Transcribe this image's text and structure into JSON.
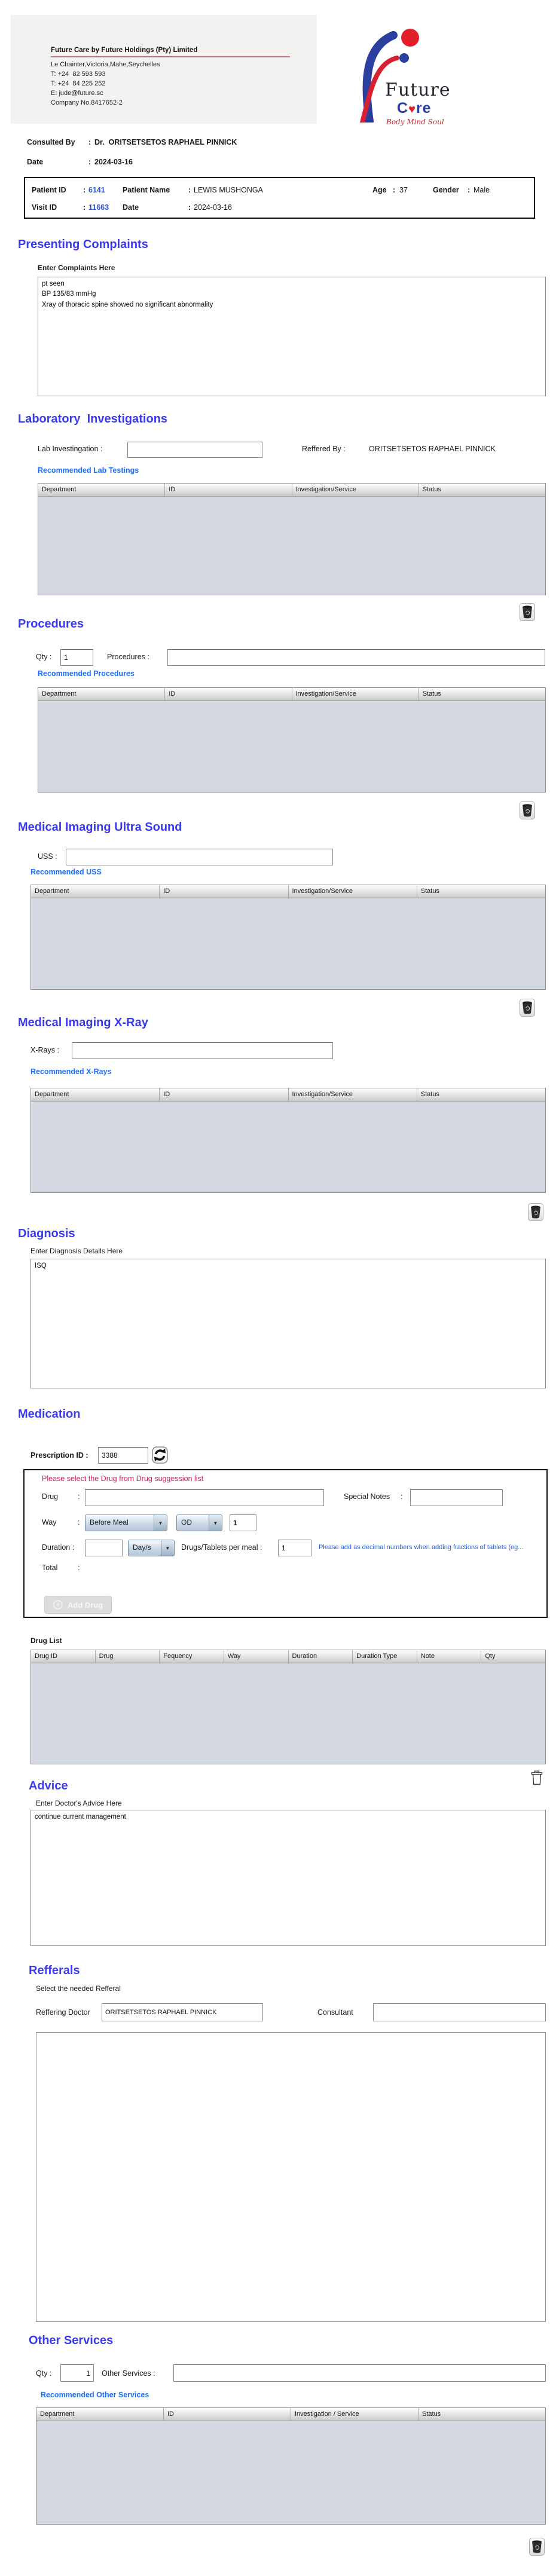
{
  "punct": {
    "colon": ":"
  },
  "icons": {
    "dropdown_arrow": "▼",
    "plus": "+",
    "heart": "♥"
  },
  "colors": {
    "heading_blue": "#3a3af0",
    "link_blue": "#1d6ff5",
    "id_blue": "#2f55d4",
    "warning_red": "#e0155a",
    "hint_blue": "#1e56d8",
    "logo_blue": "#2b3f9e",
    "logo_red": "#e31f2b",
    "table_body_gray": "#d4d8e0"
  },
  "header": {
    "company_title": "Future Care by Future Holdings (Pty) Limited",
    "address_lines": {
      "0": "Le Chainter,Victoria,Mahe,Seychelles",
      "1": "T: +24  82 593 593",
      "2": "T: +24  84 225 252",
      "3": "E: jude@future.sc",
      "4": "Company No.8417652-2"
    },
    "logo": {
      "future": "Future",
      "care_c": "C",
      "care_re": "re",
      "tagline": "Body Mind Soul"
    }
  },
  "consultation": {
    "consulted_by_label": "Consulted By",
    "consulted_by": "Dr.  ORITSETSETOS RAPHAEL PINNICK",
    "date_label": "Date",
    "date": "2024-03-16"
  },
  "patient": {
    "patient_id_label": "Patient ID",
    "patient_id": "6141",
    "patient_name_label": "Patient Name",
    "patient_name": "LEWIS MUSHONGA",
    "age_label": "Age",
    "age": "37",
    "gender_label": "Gender",
    "gender": "Male",
    "visit_id_label": "Visit ID",
    "visit_id": "11663",
    "date_label": "Date",
    "visit_date": "2024-03-16"
  },
  "presenting_complaints": {
    "title": "Presenting Complaints",
    "label": "Enter Complaints Here",
    "value": "pt seen\nBP 135/83 mmHg\nXray of thoracic spine showed no significant abnormality"
  },
  "laboratory": {
    "title": "Laboratory  Investigations",
    "lab_label": "Lab Investingation :",
    "lab_value": "",
    "referred_by_label": "Reffered By :",
    "referred_by": "ORITSETSETOS RAPHAEL PINNICK",
    "link": "Recommended Lab Testings",
    "columns": {
      "0": "Department",
      "1": "ID",
      "2": "Investigation/Service",
      "3": "Status"
    }
  },
  "procedures": {
    "title": "Procedures",
    "qty_label": "Qty :",
    "qty": "1",
    "procedures_label": "Procedures :",
    "procedures_value": "",
    "link": "Recommended Procedures",
    "columns": {
      "0": "Department",
      "1": "ID",
      "2": "Investigation/Service",
      "3": "Status"
    }
  },
  "uss": {
    "title": "Medical Imaging Ultra Sound",
    "label": "USS :",
    "value": "",
    "link": "Recommended USS",
    "columns": {
      "0": "Department",
      "1": "ID",
      "2": "Investigation/Service",
      "3": "Status"
    }
  },
  "xray": {
    "title": "Medical Imaging X-Ray",
    "label": "X-Rays :",
    "value": "",
    "link": "Recommended X-Rays",
    "columns": {
      "0": "Department",
      "1": "ID",
      "2": "Investigation/Service",
      "3": "Status"
    }
  },
  "diagnosis": {
    "title": "Diagnosis",
    "label": "Enter Diagnosis Details Here",
    "value": "ISQ"
  },
  "medication": {
    "title": "Medication",
    "prescription_id_label": "Prescription ID :",
    "prescription_id": "3388",
    "warning": "Please select the Drug from Drug suggession list",
    "drug_label": "Drug",
    "drug_value": "",
    "special_notes_label": "Special Notes",
    "special_notes_value": "",
    "way_label": "Way",
    "way_value": "Before Meal",
    "frequency_value": "OD",
    "way_qty": "1",
    "duration_label": "Duration :",
    "duration_value": "",
    "duration_type": "Day/s",
    "per_meal_label": "Drugs/Tablets per meal :",
    "per_meal": "1",
    "hint": "Please add as decimal numbers when adding fractions of tablets (eg...",
    "total_label": "Total",
    "add_drug_label": "Add Drug",
    "drug_list_label": "Drug List",
    "columns": {
      "0": "Drug ID",
      "1": "Drug",
      "2": "Fequency",
      "3": "Way",
      "4": "Duration",
      "5": "Duration Type",
      "6": "Note",
      "7": "Qty"
    }
  },
  "advice": {
    "title": "Advice",
    "label": "Enter Doctor's Advice Here",
    "value": "continue current management"
  },
  "referrals": {
    "title": "Refferals",
    "label": "Select the needed Refferal",
    "referring_doctor_label": "Reffering Doctor",
    "referring_doctor": "ORITSETSETOS RAPHAEL PINNICK",
    "consultant_label": "Consultant",
    "consultant": ""
  },
  "other_services": {
    "title": "Other Services",
    "qty_label": "Qty :",
    "qty": "1",
    "label": "Other Services :",
    "value": "",
    "link": "Recommended Other Services",
    "columns": {
      "0": "Department",
      "1": "ID",
      "2": "Investigation / Service",
      "3": "Status"
    }
  }
}
